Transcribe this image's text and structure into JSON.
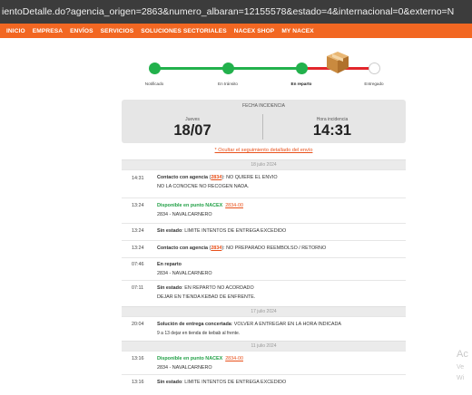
{
  "browser": {
    "url": "ientoDetalle.do?agencia_origen=2863&numero_albaran=12155578&estado=4&internacional=0&externo=N"
  },
  "nav": {
    "items": [
      "INICIO",
      "EMPRESA",
      "ENVÍOS",
      "SERVICIOS",
      "SOLUCIONES SECTORIALES",
      "NACEX SHOP",
      "MY NACEX"
    ]
  },
  "tracker": {
    "steps": [
      "Notificado",
      "En tránsito",
      "En reparto",
      "Entregado"
    ],
    "colors": {
      "done": "#22b14c",
      "current": "#e3262b",
      "pending": "#cccccc"
    }
  },
  "incidence": {
    "title": "FECHA INCIDENCIA",
    "day_label": "Jueves",
    "date": "18/07",
    "time_label": "Hora incidencia",
    "time": "14:31"
  },
  "hide_link": "* Ocultar el seguimiento detallado del envío",
  "timeline": {
    "d1": "18 julio 2024",
    "e1": {
      "time": "14:31",
      "title": "Contacto con agencia",
      "code": "2834",
      "text": ": NO QUIERE EL ENVIO",
      "line2": "NO LA CONOCNE NO RECOGEN NADA."
    },
    "e2": {
      "time": "13:24",
      "title": "Disponible en punto NACEX",
      "link": "2834-00",
      "line2": "2834 - NAVALCARNERO"
    },
    "e3": {
      "time": "13:24",
      "title": "Sin estado",
      "text": ": LIMITE INTENTOS DE ENTREGA EXCEDIDO"
    },
    "e4": {
      "time": "13:24",
      "title": "Contacto con agencia",
      "code": "2834",
      "text": ": NO PREPARADO REEMBOLSO / RETORNO"
    },
    "e5": {
      "time": "07:46",
      "title": "En reparto",
      "line2": "2834 - NAVALCARNERO"
    },
    "e6": {
      "time": "07:11",
      "title": "Sin estado",
      "text": ": EN REPARTO NO ACORDADO",
      "line2": "DEJAR EN TIENDA KEBAD DE ENFRENTE."
    },
    "d2": "17 julio 2024",
    "e7": {
      "time": "20:04",
      "title": "Solución de entrega concertada",
      "text": ": VOLVER A ENTREGAR EN LA HORA INDICADA",
      "line2": "9 a 13 dejar en tienda de kebab al frente."
    },
    "d3": "11 julio 2024",
    "e8": {
      "time": "13:16",
      "title": "Disponible en punto NACEX",
      "link": "2834-00",
      "line2": "2834 - NAVALCARNERO"
    },
    "e9": {
      "time": "13:16",
      "title": "Sin estado",
      "text": ": LIMITE INTENTOS DE ENTREGA EXCEDIDO"
    }
  },
  "watermark": {
    "l1": "Ac",
    "l2": "Ve",
    "l3": "Wi"
  }
}
